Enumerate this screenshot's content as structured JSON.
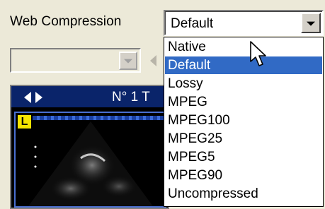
{
  "settings": {
    "web_compression_label": "Web Compression",
    "web_compression_value": "Default"
  },
  "viewer": {
    "title": "N° 1 T",
    "badge": "L"
  },
  "dropdown": {
    "items": [
      {
        "label": "Native",
        "selected": false
      },
      {
        "label": "Default",
        "selected": true
      },
      {
        "label": "Lossy",
        "selected": false
      },
      {
        "label": "MPEG",
        "selected": false
      },
      {
        "label": "MPEG100",
        "selected": false
      },
      {
        "label": "MPEG25",
        "selected": false
      },
      {
        "label": "MPEG5",
        "selected": false
      },
      {
        "label": "MPEG90",
        "selected": false
      },
      {
        "label": "Uncompressed",
        "selected": false
      }
    ]
  },
  "colors": {
    "selection": "#316ac5",
    "viewer_header": "#0a246a",
    "badge": "#f7e400",
    "window_bg": "#ece9d8"
  },
  "icons": {
    "combo_arrow": "chevron-down-icon",
    "nav_prev": "triangle-left-icon",
    "nav_next": "triangle-right-icon",
    "cursor": "arrow-cursor-icon"
  }
}
